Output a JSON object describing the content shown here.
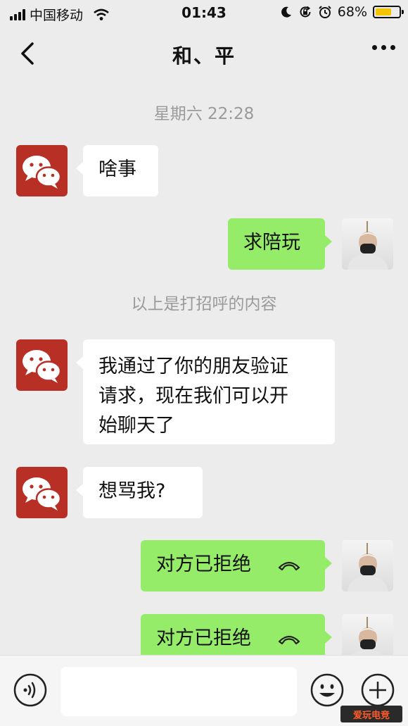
{
  "status_bar": {
    "carrier": "中国移动",
    "time": "01:43",
    "battery_percent_label": "68%",
    "battery_level": 0.68,
    "icons": [
      "signal-icon",
      "wifi-icon",
      "moon-icon",
      "rotation-lock-icon",
      "alarm-icon",
      "battery-icon"
    ]
  },
  "nav": {
    "title": "和、平",
    "back_icon": "chevron-left-icon",
    "more_icon": "more-dots-icon"
  },
  "chat": {
    "timestamp": "星期六 22:28",
    "system_notice": "以上是打招呼的内容",
    "messages": [
      {
        "side": "left",
        "text": "啥事"
      },
      {
        "side": "right",
        "text": "求陪玩"
      },
      {
        "side": "left",
        "lines": [
          "我通过了你的朋友验证",
          "请求，现在我们可以开",
          "始聊天了"
        ]
      },
      {
        "side": "left",
        "text": "想骂我?"
      },
      {
        "side": "right",
        "text": "对方已拒绝",
        "icon": "phone-hangup-icon"
      },
      {
        "side": "right",
        "text": "对方已拒绝",
        "icon": "phone-hangup-icon"
      }
    ]
  },
  "input_bar": {
    "icons": [
      "voice-icon",
      "emoji-icon",
      "plus-icon"
    ],
    "value": ""
  },
  "watermark": {
    "text": "爱玩电竞"
  },
  "colors": {
    "background": "#ececec",
    "bubble_right": "#95ec69",
    "bubble_left": "#ffffff",
    "wechat_avatar": "#b72f25",
    "battery": "#f5c400"
  }
}
